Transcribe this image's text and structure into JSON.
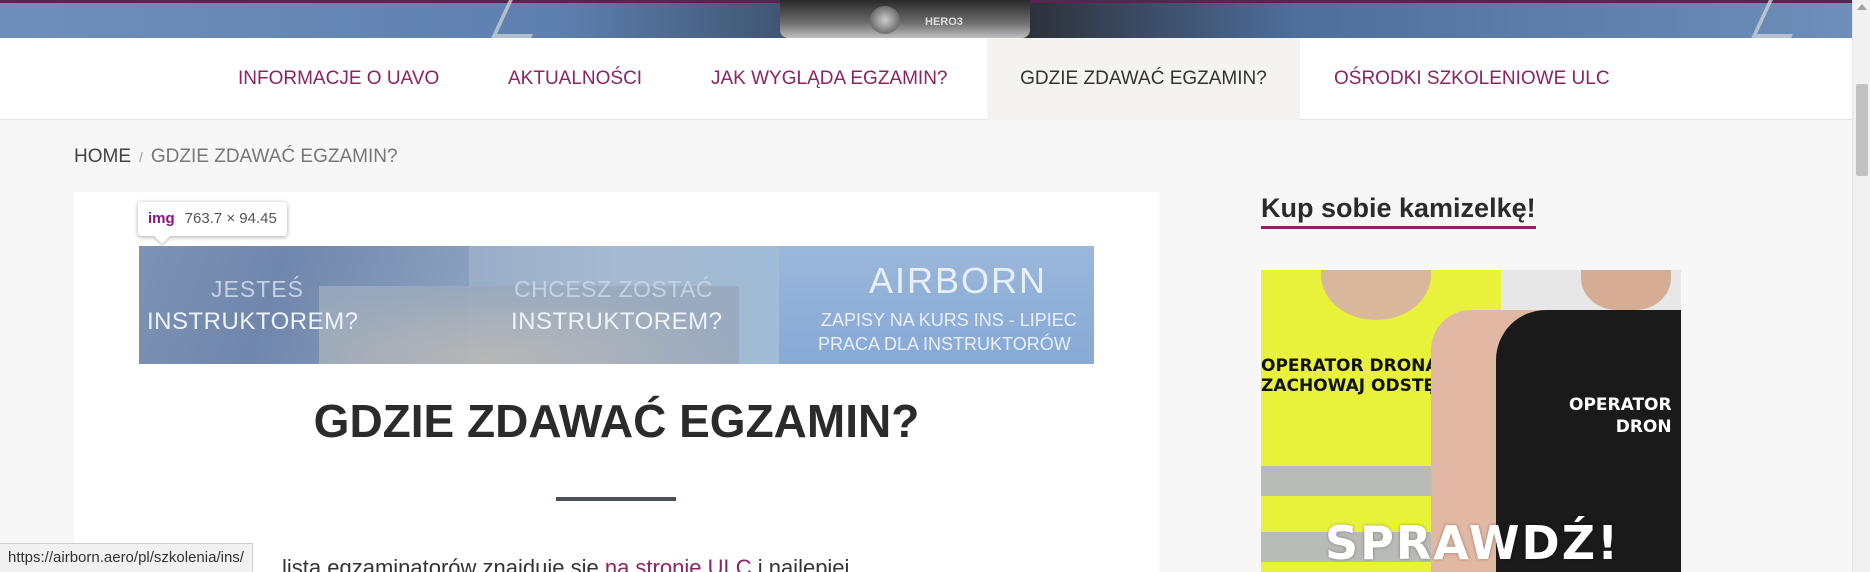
{
  "nav": {
    "items": [
      {
        "label": "INFORMACJE O UAVO",
        "active": false
      },
      {
        "label": "AKTUALNOŚCI",
        "active": false
      },
      {
        "label": "JAK WYGLĄDA EGZAMIN?",
        "active": false
      },
      {
        "label": "GDZIE ZDAWAĆ EGZAMIN?",
        "active": true
      },
      {
        "label": "OŚRODKI SZKOLENIOWE ULC",
        "active": false
      }
    ]
  },
  "hero": {
    "camera_label": "HERO3"
  },
  "breadcrumb": {
    "home": "HOME",
    "separator": "/",
    "current": "GDZIE ZDAWAĆ EGZAMIN?"
  },
  "inspector_tooltip": {
    "tag": "img",
    "dimensions": "763.7 × 94.45"
  },
  "banner": {
    "left_line1": "JESTEŚ",
    "left_line2": "INSTRUKTOREM?",
    "mid_line1": "CHCESZ ZOSTAĆ",
    "mid_line2": "INSTRUKTOREM?",
    "logo": "AIRBORN",
    "right_line1": "ZAPISY NA KURS INS - LIPIEC",
    "right_line2": "PRACA DLA INSTRUKTORÓW"
  },
  "article": {
    "title": "GDZIE ZDAWAĆ EGZAMIN?",
    "paragraph_start": "lista egzaminatorów znajduje się ",
    "paragraph_link": "na stronie ULC",
    "paragraph_end": " i najlepiej"
  },
  "status_bar": {
    "url": "https://airborn.aero/pl/szkolenia/ins/"
  },
  "sidebar": {
    "title": "Kup sobie kamizelkę!",
    "ad": {
      "vest_line1": "OPERATOR DRONA",
      "vest_line2": "ZACHOWAJ ODSTĘP",
      "shirt_line1": "OPERATOR",
      "shirt_line2": "DRON",
      "cta": "SPRAWDŹ!"
    }
  },
  "colors": {
    "accent": "#8a2462",
    "heading": "#2b2b2b",
    "active_tab_bg": "#f4f3ef"
  }
}
